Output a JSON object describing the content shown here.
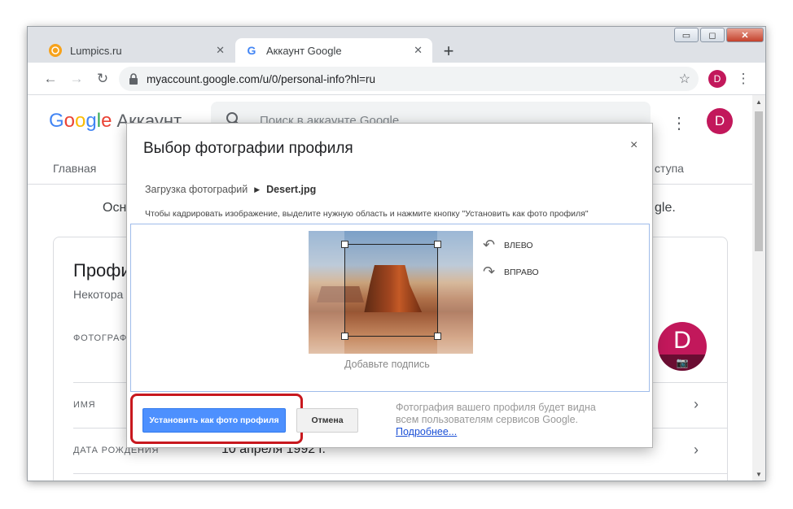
{
  "window": {
    "minimize": "▭",
    "maximize": "◻",
    "close": "✕"
  },
  "tabs": [
    {
      "label": "Lumpics.ru",
      "close": "✕"
    },
    {
      "label": "Аккаунт Google",
      "close": "✕"
    }
  ],
  "new_tab": "+",
  "toolbar": {
    "back": "←",
    "forward": "→",
    "reload": "↻",
    "url": "myaccount.google.com/u/0/personal-info?hl=ru",
    "star": "☆",
    "avatar_letter": "D",
    "menu": "⋮"
  },
  "page": {
    "logo": {
      "g": "G",
      "o1": "o",
      "o2": "o",
      "g2": "g",
      "l": "l",
      "e": "e",
      "suffix": "Аккаунт"
    },
    "search_placeholder": "Поиск в аккаунте Google",
    "avatar_letter": "D",
    "nav_home": "Главная",
    "nav_right": "ступа",
    "intro_left": "Осн",
    "intro_right": "gle.",
    "card_title": "Профи",
    "card_subtitle": "Некотора",
    "rows": [
      {
        "label": "ФОТОГРАФ",
        "value": ""
      },
      {
        "label": "ИМЯ",
        "value": ""
      },
      {
        "label": "ДАТА РОЖДЕНИЯ",
        "value": "10 апреля 1992 г."
      }
    ],
    "big_avatar_letter": "D"
  },
  "modal": {
    "title": "Выбор фотографии профиля",
    "close": "×",
    "breadcrumb_root": "Загрузка фотографий",
    "breadcrumb_file": "Desert.jpg",
    "hint": "Чтобы кадрировать изображение, выделите нужную область и нажмите кнопку \"Установить как фото профиля\"",
    "rotate_left": "ВЛЕВО",
    "rotate_right": "ВПРАВО",
    "caption": "Добавьте подпись",
    "set_button": "Установить как фото профиля",
    "cancel_button": "Отмена",
    "note_line1": "Фотография вашего профиля будет видна",
    "note_line2": "всем пользователям сервисов Google.",
    "note_link": "Подробнее..."
  },
  "colors": {
    "accent": "#4d90fe",
    "highlight": "#c8181e",
    "avatar": "#c2185b"
  }
}
